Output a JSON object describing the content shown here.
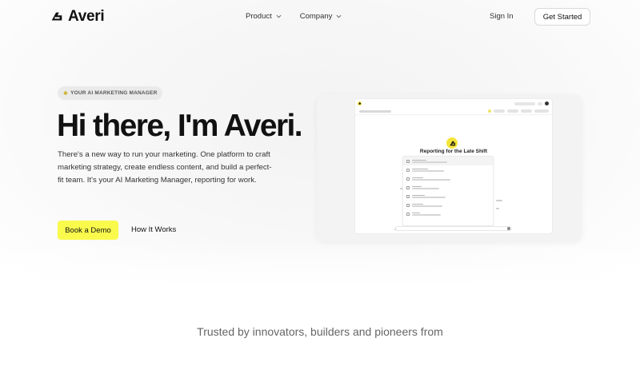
{
  "brand": {
    "name": "Averi"
  },
  "nav": {
    "items": [
      {
        "label": "Product"
      },
      {
        "label": "Company"
      }
    ],
    "signin_label": "Sign In",
    "cta_label": "Get Started"
  },
  "hero": {
    "badge": "YOUR AI MARKETING MANAGER",
    "headline": "Hi there, I'm Averi.",
    "description": "There's a new way to run your marketing. One platform to craft marketing strategy, create endless content, and build a perfect-fit team. It's your AI Marketing Manager, reporting for work.",
    "primary_cta": "Book a Demo",
    "secondary_cta": "How It Works"
  },
  "preview": {
    "heading": "Reporting for the Late Shift"
  },
  "trusted": {
    "text": "Trusted by innovators, builders and pioneers from"
  },
  "colors": {
    "accent_yellow": "#fafa4d",
    "text_dark": "#111111",
    "badge_bg": "#eaeaea"
  },
  "icons": {
    "logo": "averi-logo-icon",
    "chevron": "chevron-down-icon",
    "badge": "sparkle-icon"
  }
}
